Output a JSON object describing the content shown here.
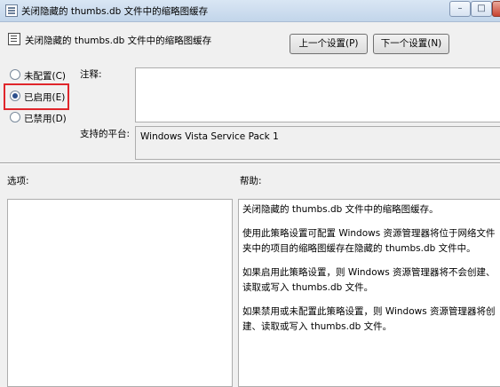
{
  "window": {
    "title": "关闭隐藏的 thumbs.db 文件中的缩略图缓存"
  },
  "header": {
    "title": "关闭隐藏的 thumbs.db 文件中的缩略图缓存",
    "prev_button": "上一个设置(P)",
    "next_button": "下一个设置(N)"
  },
  "radios": [
    {
      "label": "未配置(C)",
      "checked": false
    },
    {
      "label": "已启用(E)",
      "checked": true
    },
    {
      "label": "已禁用(D)",
      "checked": false
    }
  ],
  "comment": {
    "label": "注释:",
    "value": ""
  },
  "platform": {
    "label": "支持的平台:",
    "value": "Windows Vista Service Pack 1"
  },
  "options": {
    "label": "选项:"
  },
  "help": {
    "label": "帮助:",
    "paragraphs": [
      "关闭隐藏的 thumbs.db 文件中的缩略图缓存。",
      "使用此策略设置可配置 Windows 资源管理器将位于网络文件夹中的项目的缩略图缓存在隐藏的 thumbs.db 文件中。",
      "如果启用此策略设置，则 Windows 资源管理器将不会创建、读取或写入 thumbs.db 文件。",
      "如果禁用或未配置此策略设置，则 Windows 资源管理器将创建、读取或写入 thumbs.db 文件。"
    ]
  },
  "colors": {
    "highlight": "#e0262b",
    "radio_checked": "#2b4f8c"
  }
}
